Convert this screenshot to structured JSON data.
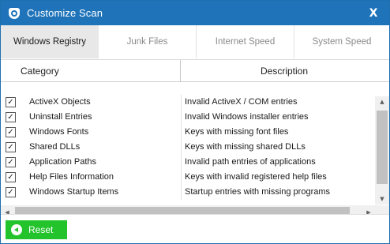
{
  "window": {
    "title": "Customize Scan",
    "close_label": "X",
    "icon": "shield-gear-icon"
  },
  "tabs": [
    {
      "label": "Windows Registry",
      "active": true
    },
    {
      "label": "Junk Files",
      "active": false
    },
    {
      "label": "Internet Speed",
      "active": false
    },
    {
      "label": "System Speed",
      "active": false
    }
  ],
  "table": {
    "columns": {
      "category": "Category",
      "description": "Description"
    },
    "rows": [
      {
        "checked": true,
        "category": "ActiveX Objects",
        "description": "Invalid ActiveX / COM entries"
      },
      {
        "checked": true,
        "category": "Uninstall Entries",
        "description": "Invalid Windows installer entries"
      },
      {
        "checked": true,
        "category": "Windows Fonts",
        "description": "Keys with missing font files"
      },
      {
        "checked": true,
        "category": "Shared DLLs",
        "description": "Keys with missing shared DLLs"
      },
      {
        "checked": true,
        "category": "Application Paths",
        "description": "Invalid path entries of applications"
      },
      {
        "checked": true,
        "category": "Help Files Information",
        "description": "Keys with invalid registered help files"
      },
      {
        "checked": true,
        "category": "Windows Startup Items",
        "description": "Startup entries with missing programs"
      }
    ]
  },
  "scrollbars": {
    "up_arrow": "▲",
    "down_arrow": "▼",
    "left_arrow": "◀",
    "right_arrow": "▶"
  },
  "footer": {
    "reset_label": "Reset",
    "reset_icon": "back-arrow-circle-icon"
  },
  "colors": {
    "titlebar": "#1e73b9",
    "active_tab": "#e8e8e8",
    "reset_button": "#22c32b"
  }
}
